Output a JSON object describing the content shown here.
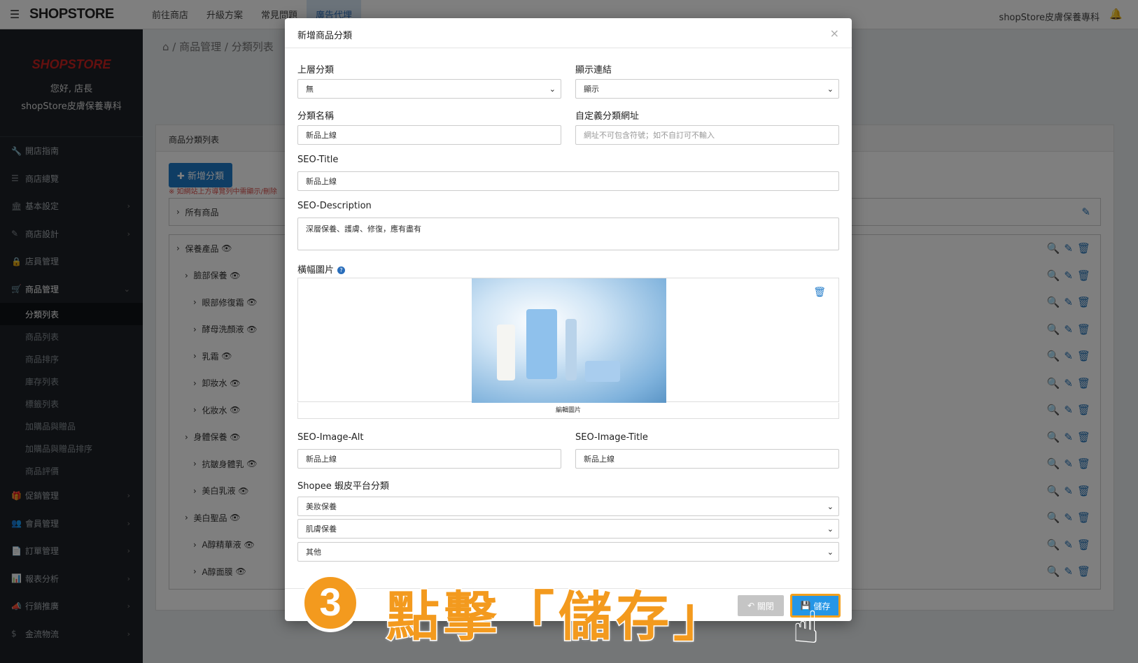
{
  "topbar": {
    "logo": "SHOPSTORE",
    "nav": [
      "前往商店",
      "升級方案",
      "常見問題",
      "廣告代埋"
    ],
    "store_name": "shopStore皮膚保養專科"
  },
  "sidebar": {
    "brand_logo": "SHOPSTORE",
    "greeting": "您好, 店長",
    "store_name": "shopStore皮膚保養專科",
    "menu": [
      {
        "label": "開店指南",
        "icon": "🔧"
      },
      {
        "label": "商店總覽",
        "icon": "☰"
      },
      {
        "label": "基本設定",
        "icon": "🏛"
      },
      {
        "label": "商店設計",
        "icon": "✎"
      },
      {
        "label": "店員管理",
        "icon": "🔒"
      },
      {
        "label": "商品管理",
        "icon": "🛒"
      }
    ],
    "submenu": [
      "分類列表",
      "商品列表",
      "商品排序",
      "庫存列表",
      "標籤列表",
      "加購品與贈品",
      "加購品與贈品排序",
      "商品評價"
    ],
    "menu2": [
      {
        "label": "促銷管理",
        "icon": "🎁"
      },
      {
        "label": "會員管理",
        "icon": "👥"
      },
      {
        "label": "訂單管理",
        "icon": "📄"
      },
      {
        "label": "報表分析",
        "icon": "📊"
      },
      {
        "label": "行銷推廣",
        "icon": "📣"
      },
      {
        "label": "金流物流",
        "icon": "$"
      }
    ]
  },
  "main": {
    "breadcrumb": "⌂ / 商品管理 / 分類列表",
    "panel_title": "商品分類列表",
    "add_button": "✚ 新增分類",
    "warning": "※ 如網站上方導覽列中需顯示/刪除",
    "all_products": "所有商品",
    "tree": [
      {
        "label": "保養產品",
        "indent": 0
      },
      {
        "label": "臉部保養",
        "indent": 1
      },
      {
        "label": "眼部修復霜",
        "indent": 2
      },
      {
        "label": "酵母洗顏液",
        "indent": 2
      },
      {
        "label": "乳霜",
        "indent": 2
      },
      {
        "label": "卸妝水",
        "indent": 2
      },
      {
        "label": "化妝水",
        "indent": 2
      },
      {
        "label": "身體保養",
        "indent": 1
      },
      {
        "label": "抗皺身體乳",
        "indent": 2
      },
      {
        "label": "美白乳液",
        "indent": 2
      },
      {
        "label": "美白聖品",
        "indent": 1
      },
      {
        "label": "A醇精華液",
        "indent": 2
      },
      {
        "label": "A醇面膜",
        "indent": 2
      }
    ]
  },
  "modal": {
    "title": "新增商品分類",
    "parent_label": "上層分類",
    "parent_value": "無",
    "display_label": "顯示連結",
    "display_value": "顯示",
    "name_label": "分類名稱",
    "name_value": "新品上線",
    "url_label": "自定義分類網址",
    "url_placeholder": "網址不可包含符號；如不自訂可不輸入",
    "seo_title_label": "SEO-Title",
    "seo_title_value": "新品上線",
    "seo_desc_label": "SEO-Description",
    "seo_desc_value": "深層保養、護膚、修復，應有盡有",
    "banner_label": "橫幅圖片",
    "banner_caption": "編輯圖片",
    "img_alt_label": "SEO-Image-Alt",
    "img_alt_value": "新品上線",
    "img_title_label": "SEO-Image-Title",
    "img_title_value": "新品上線",
    "shopee_label": "Shopee 蝦皮平台分類",
    "shopee_values": [
      "美妝保養",
      "肌膚保養",
      "其他"
    ],
    "close_button": "關閉",
    "save_button": "儲存"
  },
  "annotation": {
    "step": "3",
    "text": "點擊「儲存」"
  },
  "colors": {
    "accent": "#1f7ac9",
    "annotation": "#f39a1e",
    "sidebar_bg": "#1c2127"
  }
}
